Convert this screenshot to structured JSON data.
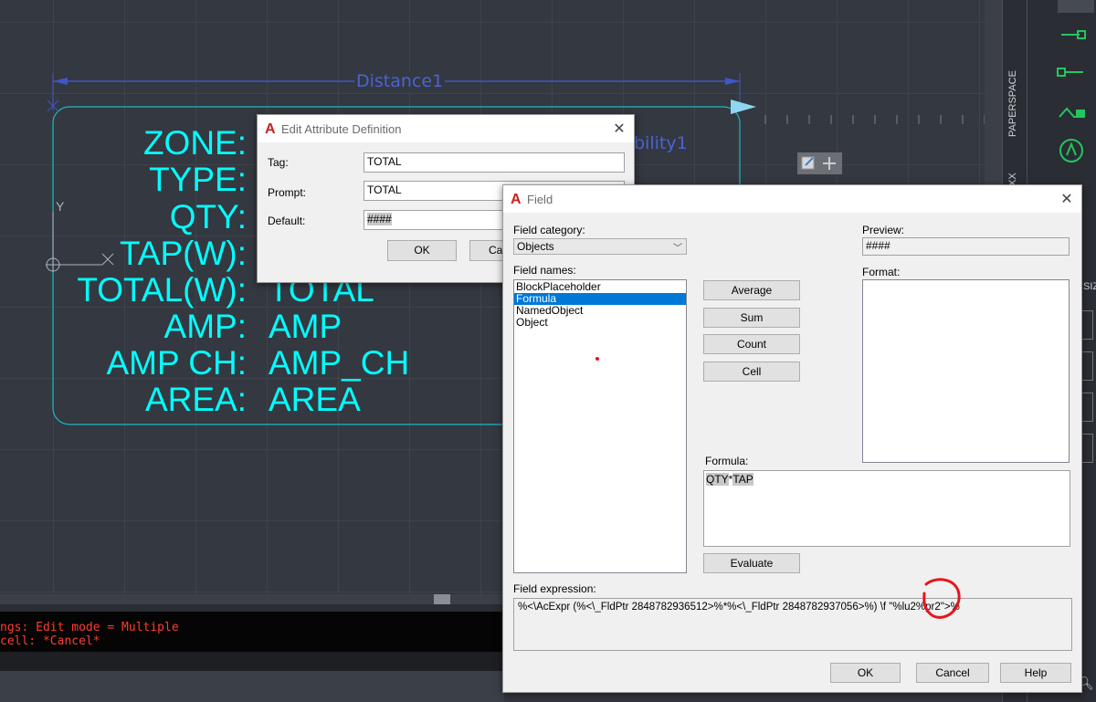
{
  "canvas": {
    "labels": [
      "ZONE:",
      "TYPE:",
      "QTY:",
      "TAP(W):",
      "TOTAL(W):",
      "AMP:",
      "AMP CH:",
      "AREA:"
    ],
    "values": [
      "TOTAL",
      "AMP",
      "AMP_CH",
      "AREA"
    ],
    "dimension": "Distance1",
    "visibility": "bility1",
    "axis_y": "Y",
    "axis_x": "X"
  },
  "right_panel": {
    "tab_paperspace": "PAPERSPACE",
    "tab_xx": "XX",
    "size_label": "SIZ"
  },
  "command_line": {
    "line1": "ngs: Edit mode = Multiple",
    "line2": "cell: *Cancel*"
  },
  "edit_attr": {
    "title": "Edit Attribute Definition",
    "tag_label": "Tag:",
    "tag_value": "TOTAL",
    "prompt_label": "Prompt:",
    "prompt_value": "TOTAL",
    "default_label": "Default:",
    "default_value": "####",
    "ok": "OK",
    "cancel": "Ca"
  },
  "field": {
    "title": "Field",
    "category_label": "Field category:",
    "category_value": "Objects",
    "names_label": "Field names:",
    "names": [
      "BlockPlaceholder",
      "Formula",
      "NamedObject",
      "Object"
    ],
    "selected_index": 1,
    "average": "Average",
    "sum": "Sum",
    "count": "Count",
    "cell": "Cell",
    "preview_label": "Preview:",
    "preview_value": "####",
    "format_label": "Format:",
    "formula_label": "Formula:",
    "formula_part1": "QTY",
    "formula_op": "*",
    "formula_part2": "TAP",
    "evaluate": "Evaluate",
    "expression_label": "Field expression:",
    "expression_value": "%<\\AcExpr (%<\\_FldPtr 2848782936512>%*%<\\_FldPtr 2848782937056>%) \\f \"%lu2%pr2\">%",
    "ok": "OK",
    "cancel": "Cancel",
    "help": "Help"
  },
  "colors": {
    "cad_text": "#00ffff",
    "dimension": "#4a63d6",
    "selection": "#0078d7",
    "annotation": "#e8141c"
  }
}
